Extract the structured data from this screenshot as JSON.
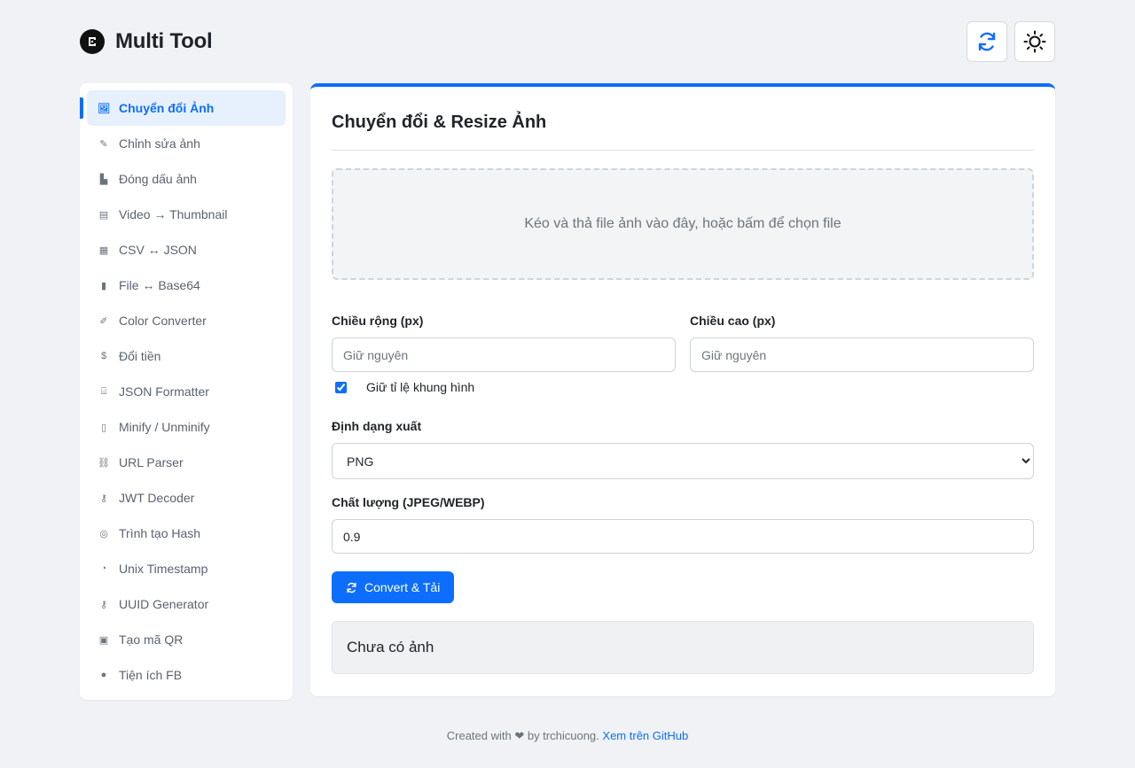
{
  "app": {
    "title": "Multi Tool"
  },
  "colors": {
    "accent": "#0d6efd",
    "background": "#f0f2f5"
  },
  "header": {
    "refresh_icon": "refresh-icon",
    "theme_icon": "sun-icon"
  },
  "sidebar": {
    "items": [
      {
        "label": "Chuyển đổi Ảnh",
        "icon": "image-icon",
        "glyph": "🖼",
        "active": true
      },
      {
        "label": "Chỉnh sửa ảnh",
        "icon": "pencil-icon",
        "glyph": "✎"
      },
      {
        "label": "Đóng dấu ảnh",
        "icon": "stamp-icon",
        "glyph": "▙"
      },
      {
        "label": "Video → Thumbnail",
        "icon": "film-icon",
        "glyph": "▤"
      },
      {
        "label": "CSV ↔ JSON",
        "icon": "csv-file-icon",
        "glyph": "▦"
      },
      {
        "label": "File ↔ Base64",
        "icon": "file-icon",
        "glyph": "▮"
      },
      {
        "label": "Color Converter",
        "icon": "brush-icon",
        "glyph": "✐"
      },
      {
        "label": "Đổi tiền",
        "icon": "coin-icon",
        "glyph": "$"
      },
      {
        "label": "JSON Formatter",
        "icon": "code-icon",
        "glyph": "⌸"
      },
      {
        "label": "Minify / Unminify",
        "icon": "file-code-icon",
        "glyph": "▯"
      },
      {
        "label": "URL Parser",
        "icon": "link-icon",
        "glyph": "⛓"
      },
      {
        "label": "JWT Decoder",
        "icon": "key-icon",
        "glyph": "⚷"
      },
      {
        "label": "Trình tạo Hash",
        "icon": "fingerprint-icon",
        "glyph": "◎"
      },
      {
        "label": "Unix Timestamp",
        "icon": "stopwatch-icon",
        "glyph": "◔"
      },
      {
        "label": "UUID Generator",
        "icon": "key-icon",
        "glyph": "⚷"
      },
      {
        "label": "Tạo mã QR",
        "icon": "qrcode-icon",
        "glyph": "▣"
      },
      {
        "label": "Tiện ích FB",
        "icon": "facebook-icon",
        "glyph": "●"
      }
    ]
  },
  "main": {
    "title": "Chuyển đổi & Resize Ảnh",
    "dropzone_text": "Kéo và thả file ảnh vào đây, hoặc bấm để chọn file",
    "width_label": "Chiều rộng (px)",
    "width_placeholder": "Giữ nguyên",
    "height_label": "Chiều cao (px)",
    "height_placeholder": "Giữ nguyên",
    "keep_ratio_label": "Giữ tỉ lệ khung hình",
    "keep_ratio_checked": true,
    "format_label": "Định dạng xuất",
    "format_value": "PNG",
    "quality_label": "Chất lượng (JPEG/WEBP)",
    "quality_value": "0.9",
    "convert_button": "Convert & Tải",
    "result_text": "Chưa có ảnh"
  },
  "footer": {
    "text": "Created with ❤ by trchicuong.",
    "link_text": "Xem trên GitHub"
  }
}
